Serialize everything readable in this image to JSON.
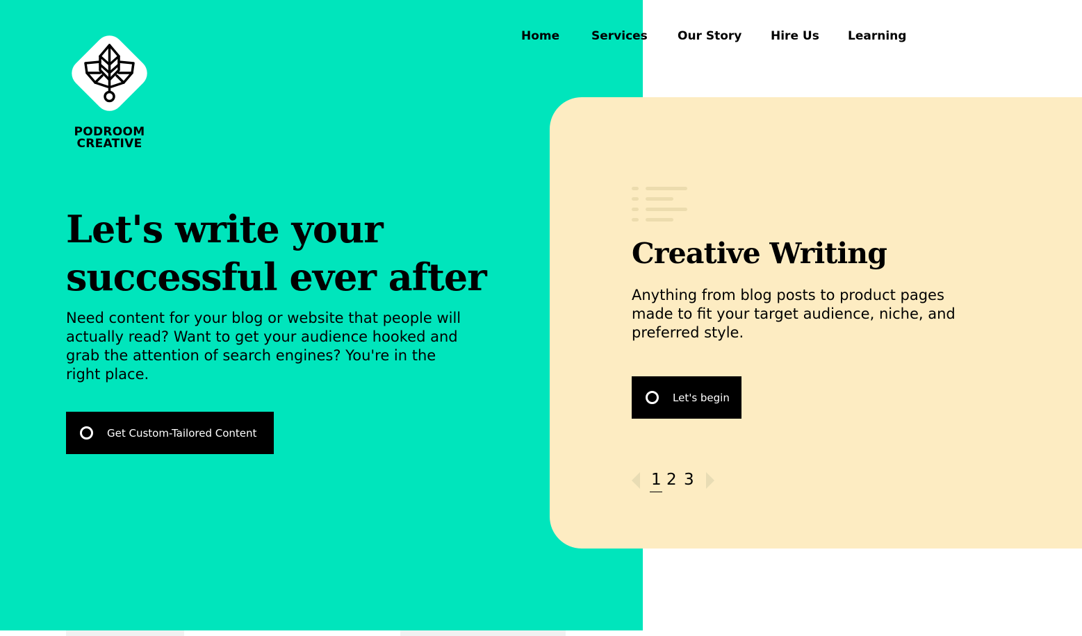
{
  "brand": {
    "name_line1": "PODROOM",
    "name_line2": "CREATIVE"
  },
  "nav": {
    "items": [
      {
        "label": "Home"
      },
      {
        "label": "Services"
      },
      {
        "label": "Our Story"
      },
      {
        "label": "Hire Us"
      },
      {
        "label": "Learning"
      }
    ]
  },
  "hero": {
    "title": "Let's write your successful ever after",
    "text": "Need content for your blog or website that people will actually read? Want to get your audience hooked and grab the attention of search engines? You're in the right place.",
    "cta_label": "Get Custom-Tailored Content"
  },
  "card": {
    "icon": "list-icon",
    "title": "Creative Writing",
    "text": "Anything from blog posts to product pages made to fit your target audience, niche, and preferred style.",
    "button_label": "Let's begin"
  },
  "pagination": {
    "pages": [
      "1",
      "2",
      "3"
    ],
    "current": "1"
  },
  "colors": {
    "accent": "#00e5bc",
    "card_bg": "#fdecc2",
    "button_bg": "#000000"
  }
}
